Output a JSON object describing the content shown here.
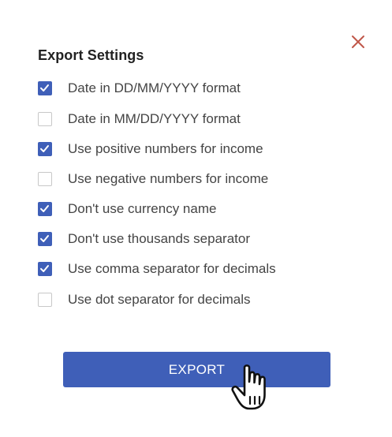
{
  "dialog": {
    "title": "Export Settings",
    "close_icon": "close-icon",
    "options": [
      {
        "label": "Date in DD/MM/YYYY format",
        "checked": true
      },
      {
        "label": "Date in MM/DD/YYYY format",
        "checked": false
      },
      {
        "label": "Use positive numbers for income",
        "checked": true
      },
      {
        "label": "Use negative numbers for income",
        "checked": false
      },
      {
        "label": "Don't use currency name",
        "checked": true
      },
      {
        "label": "Don't use thousands separator",
        "checked": true
      },
      {
        "label": "Use comma separator for decimals",
        "checked": true
      },
      {
        "label": "Use dot separator for decimals",
        "checked": false
      }
    ],
    "export_label": "EXPORT"
  },
  "colors": {
    "accent": "#3f5fb8",
    "close": "#c0584a",
    "checkbox_border": "#c8c8c8",
    "text": "#444444"
  }
}
